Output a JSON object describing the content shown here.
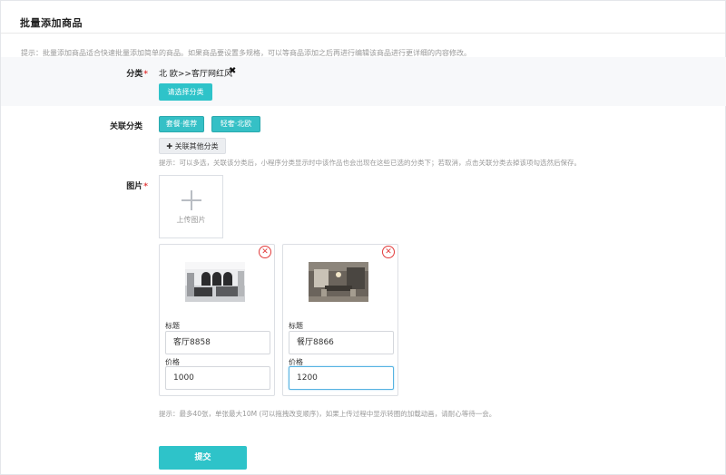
{
  "header": {
    "title": "批量添加商品"
  },
  "tips": {
    "top": "提示：批量添加商品适合快速批量添加简单的商品。如果商品要设置多规格，可以等商品添加之后再进行编辑该商品进行更详细的内容修改。",
    "category_assoc": "提示：可以多选，关联该分类后，小程序分类显示时中该作品也会出现在这些已选的分类下；若取消，点击关联分类去掉该项勾选然后保存。",
    "images": "提示：最多40张，单张最大10M (可以拖拽改变顺序)，如果上传过程中显示转圈的加载动画，请耐心等待一会。"
  },
  "category": {
    "label": "分类",
    "required_mark": "*",
    "selected": "北 欧>>客厅网红风",
    "remove_glyph": "✖",
    "choose_button": "请选择分类"
  },
  "related": {
    "label": "关联分类",
    "tags": [
      "套餐·推荐",
      "轻奢·北欧"
    ],
    "assoc_button": "✚ 关联其他分类"
  },
  "images": {
    "label": "图片",
    "required_mark": "*",
    "upload_label": "上传图片",
    "remove_glyph": "✕",
    "items": [
      {
        "title_label": "标题",
        "title_value": "客厅8858",
        "price_label": "价格",
        "price_value": "1000"
      },
      {
        "title_label": "标题",
        "title_value": "餐厅8866",
        "price_label": "价格",
        "price_value": "1200"
      }
    ]
  },
  "submit_label": "提交",
  "colors": {
    "accent": "#2ec3c9",
    "required": "#e23b3b",
    "focus": "#56b3e2"
  }
}
